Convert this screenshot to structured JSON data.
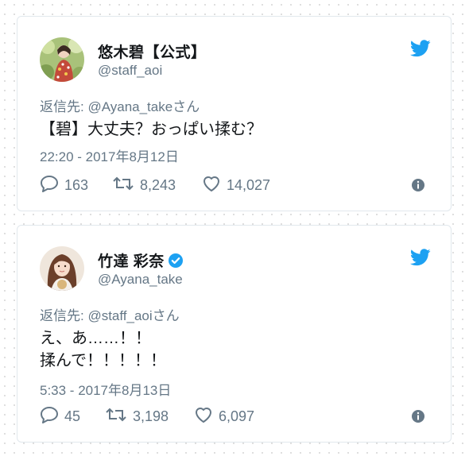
{
  "colors": {
    "twitter_blue": "#1da1f2",
    "text_primary": "#14171a",
    "text_secondary": "#657786",
    "border": "#e1e8ed"
  },
  "tweets": [
    {
      "display_name": "悠木碧【公式】",
      "handle": "@staff_aoi",
      "verified": false,
      "reply_to": "返信先: @Ayana_takeさん",
      "text_lines": [
        "【碧】大丈夫？おっぱい揉む？"
      ],
      "timestamp": "22:20 - 2017年8月12日",
      "replies": "163",
      "retweets": "8,243",
      "likes": "14,027",
      "icons": [
        "twitter-bird-icon",
        "reply-icon",
        "retweet-icon",
        "heart-icon",
        "info-icon"
      ]
    },
    {
      "display_name": "竹達 彩奈",
      "handle": "@Ayana_take",
      "verified": true,
      "reply_to": "返信先: @staff_aoiさん",
      "text_lines": [
        "え、あ……！！",
        "揉んで！！！！！"
      ],
      "timestamp": "5:33 - 2017年8月13日",
      "replies": "45",
      "retweets": "3,198",
      "likes": "6,097",
      "icons": [
        "verified-badge-icon",
        "twitter-bird-icon",
        "reply-icon",
        "retweet-icon",
        "heart-icon",
        "info-icon"
      ]
    }
  ]
}
